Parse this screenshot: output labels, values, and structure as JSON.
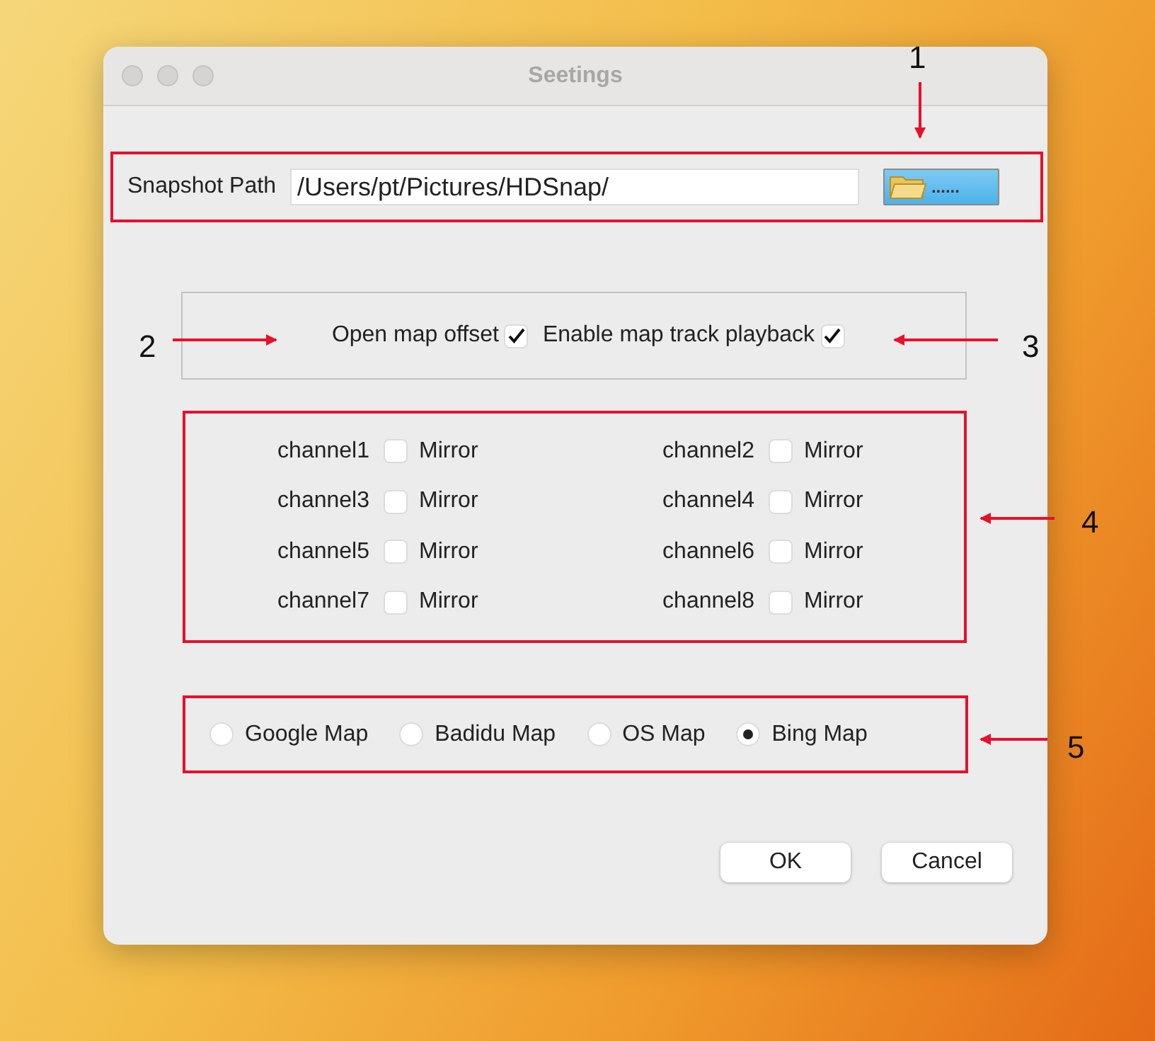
{
  "window": {
    "title": "Seetings"
  },
  "snapshot": {
    "label": "Snapshot Path",
    "value": "/Users/pt/Pictures/HDSnap/",
    "browse_label": "......"
  },
  "options": [
    {
      "label": "Open map offset",
      "checked": true
    },
    {
      "label": "Enable map track playback",
      "checked": true
    }
  ],
  "channels": [
    {
      "label": "channel1",
      "option": "Mirror",
      "checked": false
    },
    {
      "label": "channel2",
      "option": "Mirror",
      "checked": false
    },
    {
      "label": "channel3",
      "option": "Mirror",
      "checked": false
    },
    {
      "label": "channel4",
      "option": "Mirror",
      "checked": false
    },
    {
      "label": "channel5",
      "option": "Mirror",
      "checked": false
    },
    {
      "label": "channel6",
      "option": "Mirror",
      "checked": false
    },
    {
      "label": "channel7",
      "option": "Mirror",
      "checked": false
    },
    {
      "label": "channel8",
      "option": "Mirror",
      "checked": false
    }
  ],
  "map_sources": [
    {
      "label": "Google Map",
      "selected": false
    },
    {
      "label": "Badidu Map",
      "selected": false
    },
    {
      "label": "OS Map",
      "selected": false
    },
    {
      "label": "Bing Map",
      "selected": true
    }
  ],
  "buttons": [
    "OK",
    "Cancel"
  ],
  "annotations": [
    "1",
    "2",
    "3",
    "4",
    "5"
  ]
}
